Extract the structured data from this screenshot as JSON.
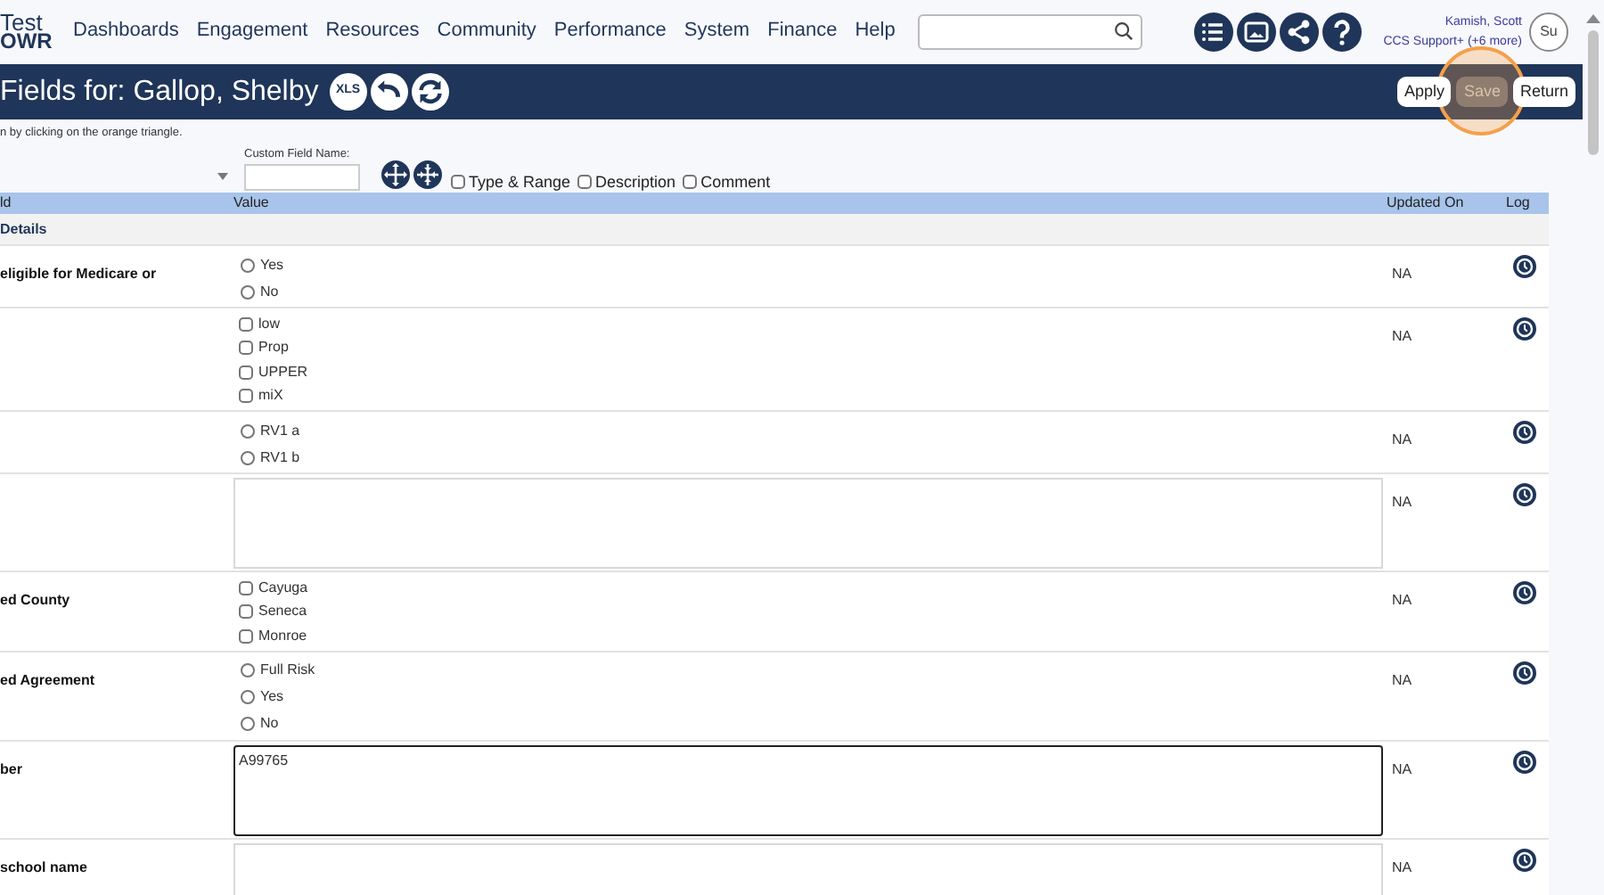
{
  "logo": {
    "line1": "Test",
    "line2": "OWR"
  },
  "nav": [
    "Dashboards",
    "Engagement",
    "Resources",
    "Community",
    "Performance",
    "System",
    "Finance",
    "Help"
  ],
  "user": {
    "name": "Kamish, Scott",
    "role": "CCS Support+ (+6 more)",
    "avatar_alt": "Su"
  },
  "title_bar": {
    "title": "Fields for: Gallop, Shelby",
    "xls": "XLS",
    "buttons": [
      {
        "label": "Apply",
        "disabled": false,
        "highlighted": false
      },
      {
        "label": "Save",
        "disabled": true,
        "highlighted": true
      },
      {
        "label": "Return",
        "disabled": false,
        "highlighted": false
      }
    ]
  },
  "hint": "n by clicking on the orange triangle.",
  "custom_field_label": "Custom Field Name:",
  "toggles": [
    {
      "label": "Type & Range",
      "checked": false
    },
    {
      "label": "Description",
      "checked": false
    },
    {
      "label": "Comment",
      "checked": false
    }
  ],
  "table": {
    "columns": [
      "ld",
      "Value",
      "Updated On",
      "Log"
    ],
    "section": "Details",
    "rows": [
      {
        "label": "eligible for Medicare or",
        "kind": "radio",
        "options": [
          {
            "label": "Yes",
            "checked": false
          },
          {
            "label": "No",
            "checked": false
          }
        ],
        "updated": "NA"
      },
      {
        "label": "",
        "kind": "checkbox",
        "options": [
          {
            "label": "low",
            "checked": false
          },
          {
            "label": "Prop",
            "checked": false
          },
          {
            "label": "UPPER",
            "checked": false
          },
          {
            "label": "miX",
            "checked": false
          }
        ],
        "updated": "NA"
      },
      {
        "label": "",
        "kind": "radio",
        "options": [
          {
            "label": "RV1 a",
            "checked": false
          },
          {
            "label": "RV1 b",
            "checked": false
          }
        ],
        "updated": "NA"
      },
      {
        "label": "",
        "kind": "textarea",
        "value": "",
        "focused": false,
        "updated": "NA"
      },
      {
        "label": "ed County",
        "kind": "checkbox",
        "options": [
          {
            "label": "Cayuga",
            "checked": false
          },
          {
            "label": "Seneca",
            "checked": false
          },
          {
            "label": "Monroe",
            "checked": false
          }
        ],
        "updated": "NA"
      },
      {
        "label": "ed Agreement",
        "kind": "radio",
        "options": [
          {
            "label": "Full Risk",
            "checked": false
          },
          {
            "label": "Yes",
            "checked": false
          },
          {
            "label": "No",
            "checked": false
          }
        ],
        "updated": "NA"
      },
      {
        "label": "ber",
        "kind": "textarea",
        "value": "A99765",
        "focused": true,
        "updated": "NA"
      },
      {
        "label": "school name",
        "kind": "textarea",
        "value": "",
        "focused": false,
        "updated": "NA"
      }
    ]
  }
}
